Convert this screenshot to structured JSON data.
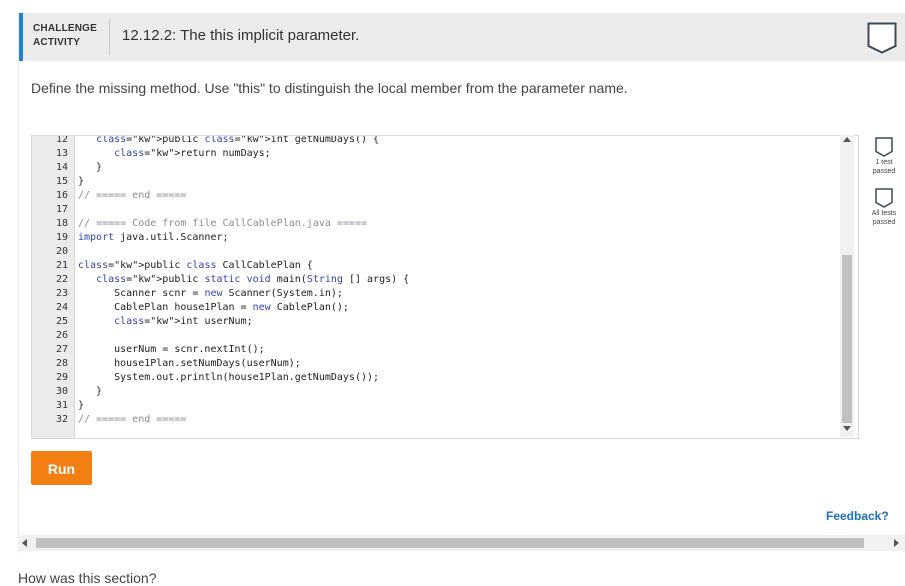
{
  "header": {
    "badge_line1": "CHALLENGE",
    "badge_line2": "ACTIVITY",
    "title": "12.12.2: The this implicit parameter.",
    "accent_color": "#1b86d1"
  },
  "prompt": "Define the missing method. Use \"this\" to distinguish the local member from the parameter name.",
  "editor": {
    "line_numbers": [
      "12",
      "13",
      "14",
      "15",
      "16",
      "17",
      "18",
      "19",
      "20",
      "21",
      "22",
      "23",
      "24",
      "25",
      "26",
      "27",
      "28",
      "29",
      "30",
      "31",
      "32"
    ],
    "code_lines": [
      "   public int getNumDays() {",
      "      return numDays;",
      "   }",
      "}",
      "// ===== end =====",
      "",
      "// ===== Code from file CallCablePlan.java =====",
      "import java.util.Scanner;",
      "",
      "public class CallCablePlan {",
      "   public static void main(String [] args) {",
      "      Scanner scnr = new Scanner(System.in);",
      "      CablePlan house1Plan = new CablePlan();",
      "      int userNum;",
      "",
      "      userNum = scnr.nextInt();",
      "      house1Plan.setNumDays(userNum);",
      "      System.out.println(house1Plan.getNumDays());",
      "   }",
      "}",
      "// ===== end ====="
    ]
  },
  "tests": [
    {
      "label": "1 test passed",
      "line1": "1 test",
      "line2": "passed",
      "icon": "shield-icon"
    },
    {
      "label": "All tests passed",
      "line1": "All tests",
      "line2": "passed",
      "icon": "shield-icon"
    }
  ],
  "run_label": "Run",
  "run_color": "#f27f11",
  "feedback_label": "Feedback?",
  "bottom_text": "How was this section?"
}
